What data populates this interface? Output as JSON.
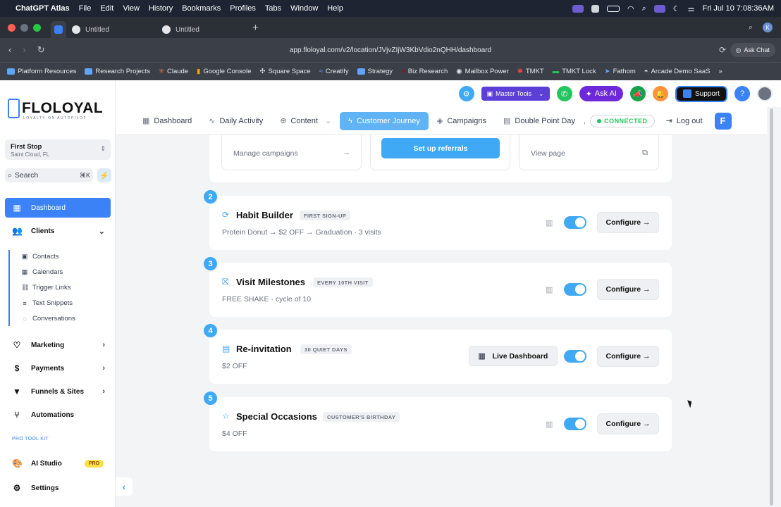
{
  "menubar": {
    "app": "ChatGPT Atlas",
    "items": [
      "File",
      "Edit",
      "View",
      "History",
      "Bookmarks",
      "Profiles",
      "Tabs",
      "Window",
      "Help"
    ],
    "datetime": "Fri Jul 10  7:08:36AM"
  },
  "tabs": [
    {
      "label": "Untitled"
    },
    {
      "label": "Untitled"
    }
  ],
  "tab_avatar": "K",
  "url": "app.floloyal.com/v2/location/JVjvZIjW3KbVdio2nQHH/dashboard",
  "ask_chat": "Ask Chat",
  "bookmarks": [
    "Platform Resources",
    "Research Projects",
    "Claude",
    "Google Console",
    "Square Space",
    "Creatify",
    "Strategy",
    "Biz Research",
    "Mailbox Power",
    "TMKT",
    "TMKT Lock",
    "Fathom",
    "Arcade Demo SaaS"
  ],
  "logo": {
    "text": "FLOLOYAL",
    "tagline": "LOYALTY ON AUTOPILOT"
  },
  "location": {
    "name": "First Stop",
    "sub": "Saint Cloud, FL"
  },
  "search": {
    "label": "Search",
    "shortcut": "⌘K"
  },
  "sidebar": {
    "dashboard": "Dashboard",
    "clients": "Clients",
    "sub": [
      "Contacts",
      "Calendars",
      "Trigger Links",
      "Text Snippets",
      "Conversations"
    ],
    "marketing": "Marketing",
    "payments": "Payments",
    "funnels": "Funnels & Sites",
    "automations": "Automations",
    "protool": "PRO TOOL KIT",
    "aistudio": "AI Studio",
    "pro_badge": "PRO",
    "settings": "Settings"
  },
  "topbar": {
    "master_tools": "Master Tools",
    "ask_ai": "Ask AI",
    "support": "Support",
    "help": "?"
  },
  "subnav": {
    "dashboard": "Dashboard",
    "daily": "Daily Activity",
    "content": "Content",
    "journey": "Customer Journey",
    "campaigns": "Campaigns",
    "dpd": "Double Point Day",
    "comma": ",",
    "connected": "CONNECTED",
    "logout": "Log out"
  },
  "topcards": {
    "manage": "Manage campaigns",
    "referrals": "Set up referrals",
    "view": "View page"
  },
  "steps": [
    {
      "num": "2",
      "title": "Habit Builder",
      "badge": "FIRST SIGN-UP",
      "desc": "Protein Donut → $2 OFF → Graduation · 3 visits",
      "configure": "Configure →",
      "enabled": true
    },
    {
      "num": "3",
      "title": "Visit Milestones",
      "badge": "EVERY 10TH VISIT",
      "desc": "FREE SHAKE · cycle of 10",
      "configure": "Configure →",
      "enabled": true
    },
    {
      "num": "4",
      "title": "Re-invitation",
      "badge": "30 QUIET DAYS",
      "desc": "$2 OFF",
      "configure": "Configure →",
      "live": "Live Dashboard",
      "enabled": true
    },
    {
      "num": "5",
      "title": "Special Occasions",
      "badge": "CUSTOMER'S BIRTHDAY",
      "desc": "$4 OFF",
      "configure": "Configure →",
      "enabled": true
    }
  ],
  "colors": {
    "accent": "#3fa9f5",
    "primary": "#3b82f6",
    "connected": "#22c55e",
    "ask_ai": "#6d28d9"
  }
}
